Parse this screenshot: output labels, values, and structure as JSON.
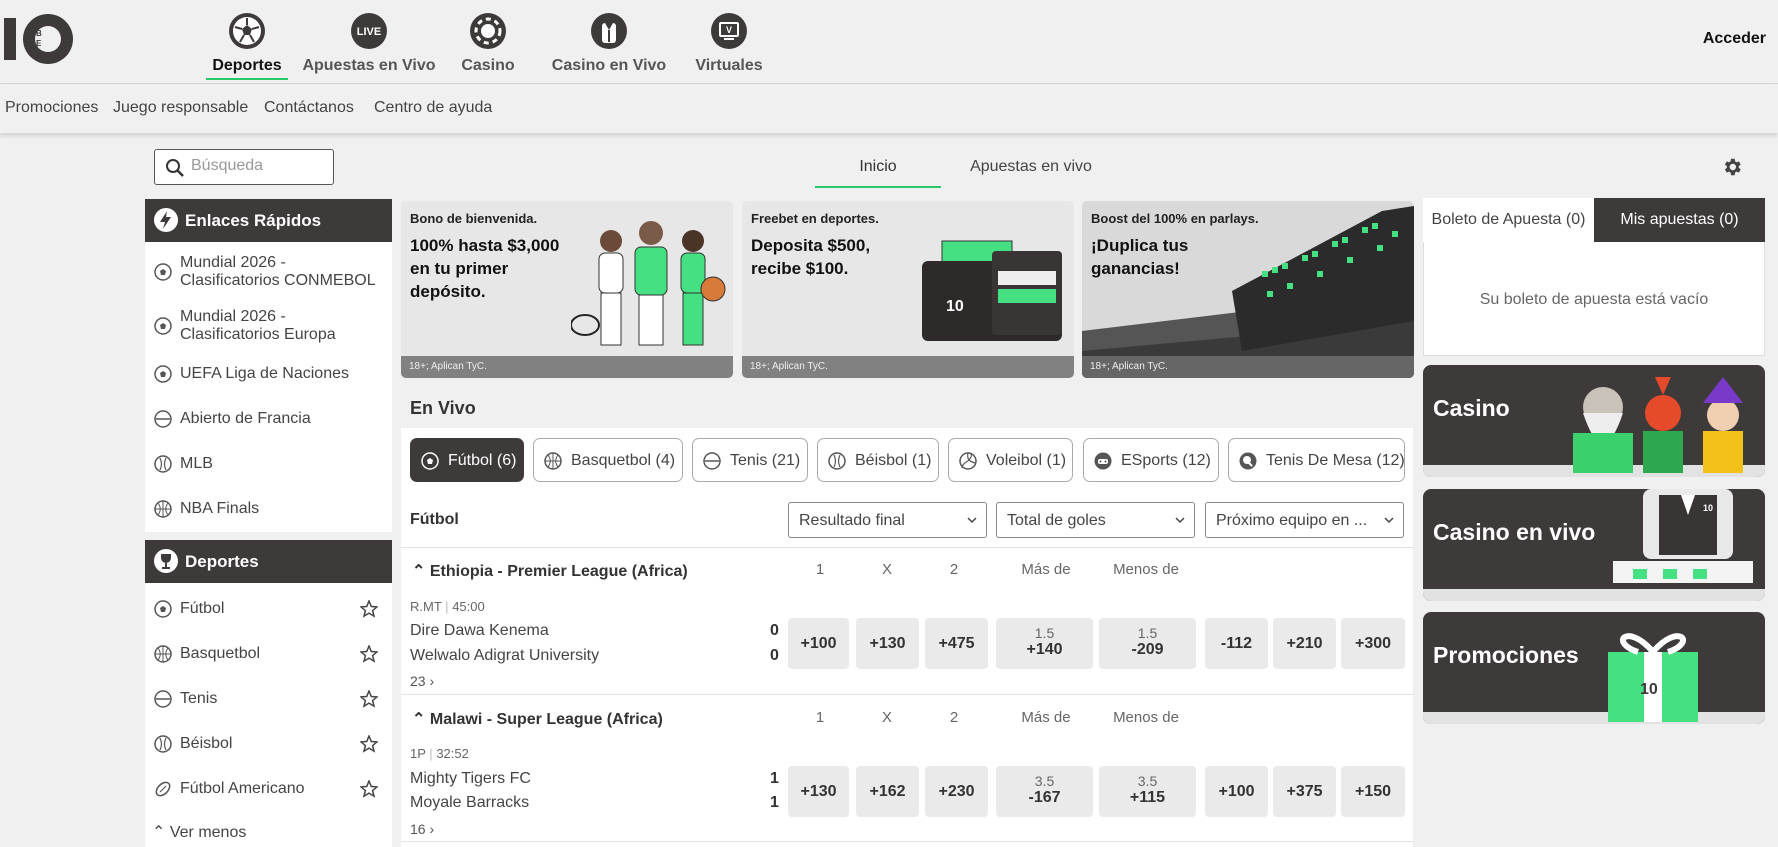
{
  "nav": {
    "items": [
      {
        "label": "Deportes",
        "icon": "soccer-ball-icon",
        "active": true
      },
      {
        "label": "Apuestas en Vivo",
        "icon": "live-icon",
        "badge": "LIVE"
      },
      {
        "label": "Casino",
        "icon": "poker-chip-icon"
      },
      {
        "label": "Casino en Vivo",
        "icon": "dealer-icon"
      },
      {
        "label": "Virtuales",
        "icon": "virtual-screen-icon",
        "badge": "V"
      }
    ],
    "login": "Acceder"
  },
  "subnav": [
    "Promociones",
    "Juego responsable",
    "Contáctanos",
    "Centro de ayuda"
  ],
  "search": {
    "placeholder": "Búsqueda"
  },
  "center_tabs": [
    {
      "label": "Inicio",
      "active": true
    },
    {
      "label": "Apuestas en vivo"
    }
  ],
  "quick_links": {
    "title": "Enlaces Rápidos",
    "items": [
      {
        "label": "Mundial 2026 - Clasificatorios CONMEBOL",
        "icon": "soccer-ball-icon"
      },
      {
        "label": "Mundial 2026 - Clasificatorios Europa",
        "icon": "soccer-ball-icon"
      },
      {
        "label": "UEFA Liga de Naciones",
        "icon": "soccer-ball-icon"
      },
      {
        "label": "Abierto de Francia",
        "icon": "tennis-ball-icon"
      },
      {
        "label": "MLB",
        "icon": "baseball-icon"
      },
      {
        "label": "NBA Finals",
        "icon": "basketball-icon"
      }
    ]
  },
  "sports": {
    "title": "Deportes",
    "items": [
      {
        "label": "Fútbol",
        "icon": "soccer-ball-icon"
      },
      {
        "label": "Basquetbol",
        "icon": "basketball-icon"
      },
      {
        "label": "Tenis",
        "icon": "tennis-ball-icon"
      },
      {
        "label": "Béisbol",
        "icon": "baseball-icon"
      },
      {
        "label": "Fútbol Americano",
        "icon": "american-football-icon"
      }
    ],
    "less": "Ver menos"
  },
  "banners": [
    {
      "tag": "Bono de bienvenida.",
      "headline": "100% hasta $3,000 en tu primer depósito.",
      "footer": "18+; Aplican TyC."
    },
    {
      "tag": "Freebet en deportes.",
      "headline": "Deposita $500, recibe $100.",
      "footer": "18+; Aplican TyC."
    },
    {
      "tag": "Boost del 100% en parlays.",
      "headline": "¡Duplica tus ganancias!",
      "footer": "18+; Aplican TyC."
    }
  ],
  "live": {
    "title": "En Vivo",
    "tabs": [
      {
        "label": "Fútbol (6)",
        "icon": "soccer-ball-icon",
        "active": true
      },
      {
        "label": "Basquetbol (4)",
        "icon": "basketball-icon"
      },
      {
        "label": "Tenis (21)",
        "icon": "tennis-ball-icon"
      },
      {
        "label": "Béisbol (1)",
        "icon": "baseball-icon"
      },
      {
        "label": "Voleibol (1)",
        "icon": "volleyball-icon"
      },
      {
        "label": "ESports (12)",
        "icon": "gamepad-icon"
      },
      {
        "label": "Tenis De Mesa (12)",
        "icon": "table-tennis-icon"
      }
    ],
    "section": "Fútbol",
    "dropdowns": [
      "Resultado final",
      "Total de goles",
      "Próximo equipo en ..."
    ],
    "col_headers": [
      "1",
      "X",
      "2",
      "Más de",
      "Menos de"
    ],
    "leagues": [
      {
        "name": "Ethiopia - Premier League (Africa)",
        "meta_period": "R.MT",
        "meta_time": "45:00",
        "home": "Dire Dawa Kenema",
        "away": "Welwalo Adigrat University",
        "home_score": "0",
        "away_score": "0",
        "odds": [
          "+100",
          "+130",
          "+475"
        ],
        "over": {
          "line": "1.5",
          "price": "+140"
        },
        "under": {
          "line": "1.5",
          "price": "-209"
        },
        "next": [
          "-112",
          "+210",
          "+300"
        ],
        "more": "23 ›"
      },
      {
        "name": "Malawi - Super League (Africa)",
        "meta_period": "1P",
        "meta_time": "32:52",
        "home": "Mighty Tigers FC",
        "away": "Moyale Barracks",
        "home_score": "1",
        "away_score": "1",
        "odds": [
          "+130",
          "+162",
          "+230"
        ],
        "over": {
          "line": "3.5",
          "price": "-167"
        },
        "under": {
          "line": "3.5",
          "price": "+115"
        },
        "next": [
          "+100",
          "+375",
          "+150"
        ],
        "more": "16 ›"
      }
    ]
  },
  "betslip": {
    "tab_slip": "Boleto de Apuesta (0)",
    "tab_mine": "Mis apuestas (0)",
    "empty": "Su boleto de apuesta está vacío"
  },
  "promos": [
    "Casino",
    "Casino en vivo",
    "Promociones"
  ],
  "colors": {
    "accent": "#29c86a",
    "dark": "#3f3a3a",
    "bg": "#f0f0f0"
  }
}
